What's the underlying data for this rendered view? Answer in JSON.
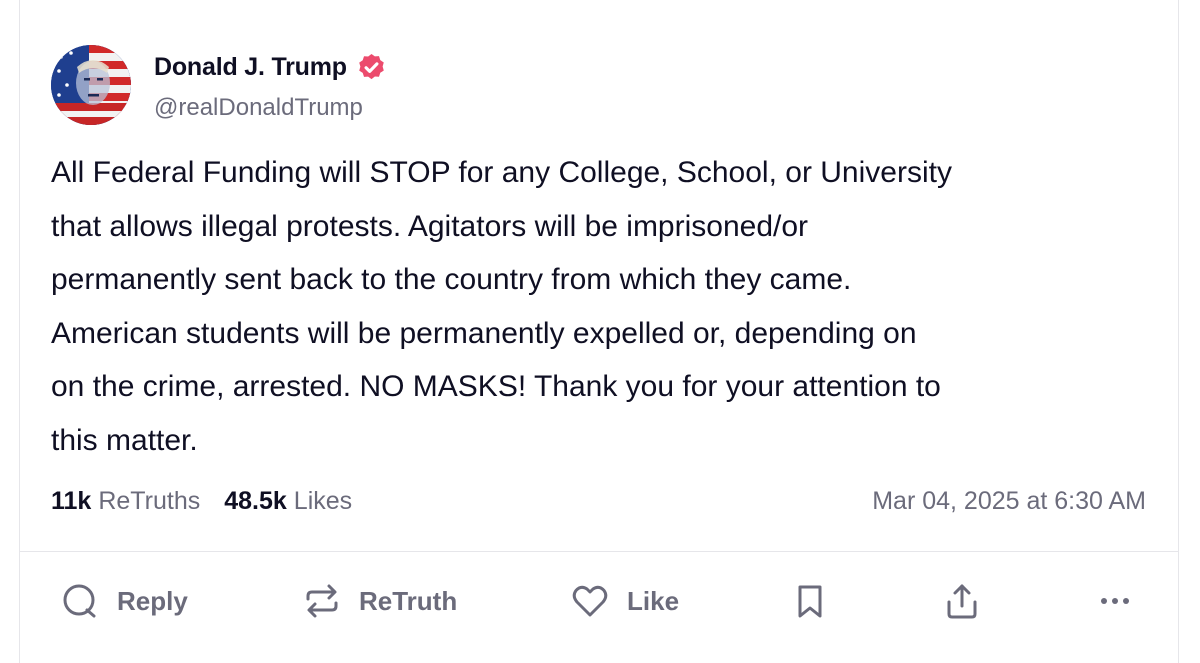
{
  "post": {
    "author": {
      "display_name": "Donald J. Trump",
      "handle": "@realDonaldTrump",
      "verified_icon": "verified-badge-icon",
      "avatar": "avatar-flag-portrait"
    },
    "text": "All Federal Funding will STOP for any College, School, or University\nthat allows illegal protests. Agitators will be imprisoned/or\npermanently sent back to the country from which they came.\nAmerican students will be permanently expelled or, depending on\non the crime, arrested. NO MASKS! Thank you for your attention to\nthis matter.",
    "stats": {
      "retruths_count": "11k",
      "retruths_label": "ReTruths",
      "likes_count": "48.5k",
      "likes_label": "Likes"
    },
    "timestamp": "Mar 04, 2025 at 6:30 AM"
  },
  "actions": {
    "reply": {
      "label": "Reply",
      "icon": "reply-icon"
    },
    "retruth": {
      "label": "ReTruth",
      "icon": "retruth-icon"
    },
    "like": {
      "label": "Like",
      "icon": "heart-icon"
    },
    "bookmark": {
      "icon": "bookmark-icon"
    },
    "share": {
      "icon": "share-icon"
    },
    "more": {
      "icon": "more-icon"
    }
  },
  "colors": {
    "text_primary": "#0f0f23",
    "text_secondary": "#6b6b7b",
    "verified_badge": "#ec4b6d",
    "divider": "#e6e6ea"
  }
}
